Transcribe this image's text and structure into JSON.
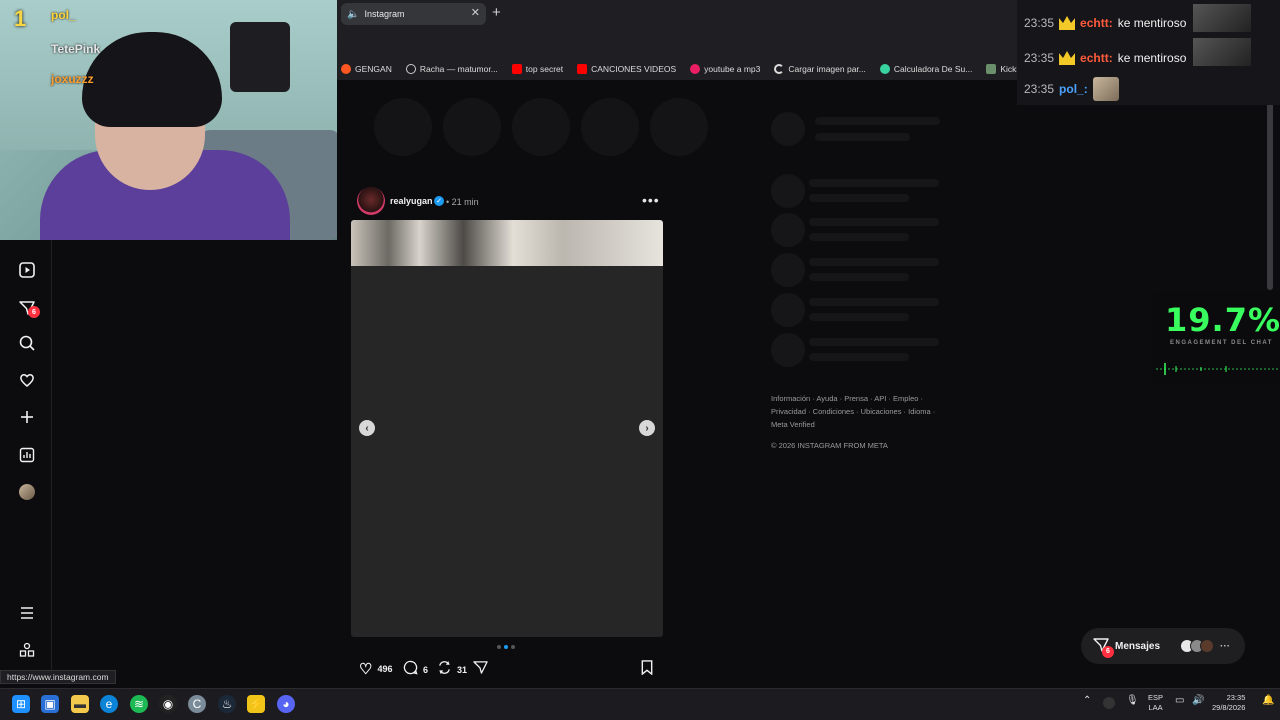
{
  "browser": {
    "tab_title": "Instagram",
    "bookmarks": [
      "GENGAN",
      "Racha — matumor...",
      "top secret",
      "CANCIONES VIDEOS",
      "youtube a mp3",
      "Cargar imagen par...",
      "Calculadora De Su...",
      "Kicklet - Kick C..."
    ],
    "status_url": "https://www.instagram.com"
  },
  "webcam": {
    "rank": "1",
    "chatters": [
      {
        "name": "pol_",
        "color": "#ffd43b"
      },
      {
        "name": "TetePink",
        "color": "#e6e6e6"
      },
      {
        "name": "joxuzzz",
        "color": "#ff9f2e"
      }
    ]
  },
  "left_nav": {
    "notification_badge": "6"
  },
  "post": {
    "username": "realyugan",
    "time": "21 min",
    "likes": "496",
    "comments": "6",
    "reposts": "31"
  },
  "sidebar_footer": {
    "links": "Información · Ayuda · Prensa · API · Empleo · Privacidad · Condiciones · Ubicaciones · Idioma · Meta Verified",
    "copyright": "© 2026 INSTAGRAM FROM META"
  },
  "stream_chat": {
    "messages": [
      {
        "time": "23:35",
        "user": "echtt:",
        "text": "ke mentiroso"
      },
      {
        "time": "23:35",
        "user": "echtt:",
        "text": "ke mentiroso"
      },
      {
        "time": "23:35",
        "user": "pol_:",
        "text": ""
      }
    ]
  },
  "engagement": {
    "value": "19.7%",
    "label": "ENGAGEMENT DEL CHAT"
  },
  "messages_pill": {
    "label": "Mensajes",
    "badge": "6"
  },
  "taskbar": {
    "lang_top": "ESP",
    "lang_bottom": "LAA",
    "time": "23:35",
    "date": "29/8/2026"
  },
  "colors": {
    "accent_blue": "#1d9bf0",
    "badge_red": "#ff3040",
    "engagement_green": "#38ff5e"
  }
}
